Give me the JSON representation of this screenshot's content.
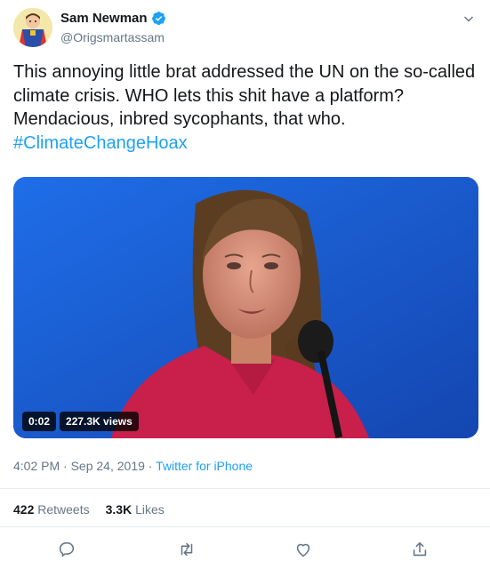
{
  "author": {
    "display_name": "Sam Newman",
    "handle": "@Origsmartassam",
    "verified": true
  },
  "tweet": {
    "text": "This annoying little brat addressed the UN on the so-called climate crisis. WHO lets this shit have a platform? Mendacious, inbred sycophants, that who.",
    "hashtag": "#ClimateChangeHoax"
  },
  "video": {
    "duration": "0:02",
    "views": "227.3K views"
  },
  "meta": {
    "time": "4:02 PM",
    "separator": "·",
    "date": "Sep 24, 2019",
    "source": "Twitter for iPhone"
  },
  "stats": {
    "retweets_count": "422",
    "retweets_label": "Retweets",
    "likes_count": "3.3K",
    "likes_label": "Likes"
  },
  "icons": {
    "reply": "reply-icon",
    "retweet": "retweet-icon",
    "like": "heart-icon",
    "share": "share-icon",
    "menu": "chevron-down-icon",
    "verified": "verified-badge-icon"
  },
  "colors": {
    "accent": "#1da1f2",
    "secondary_text": "#657786",
    "primary_text": "#14171a"
  }
}
